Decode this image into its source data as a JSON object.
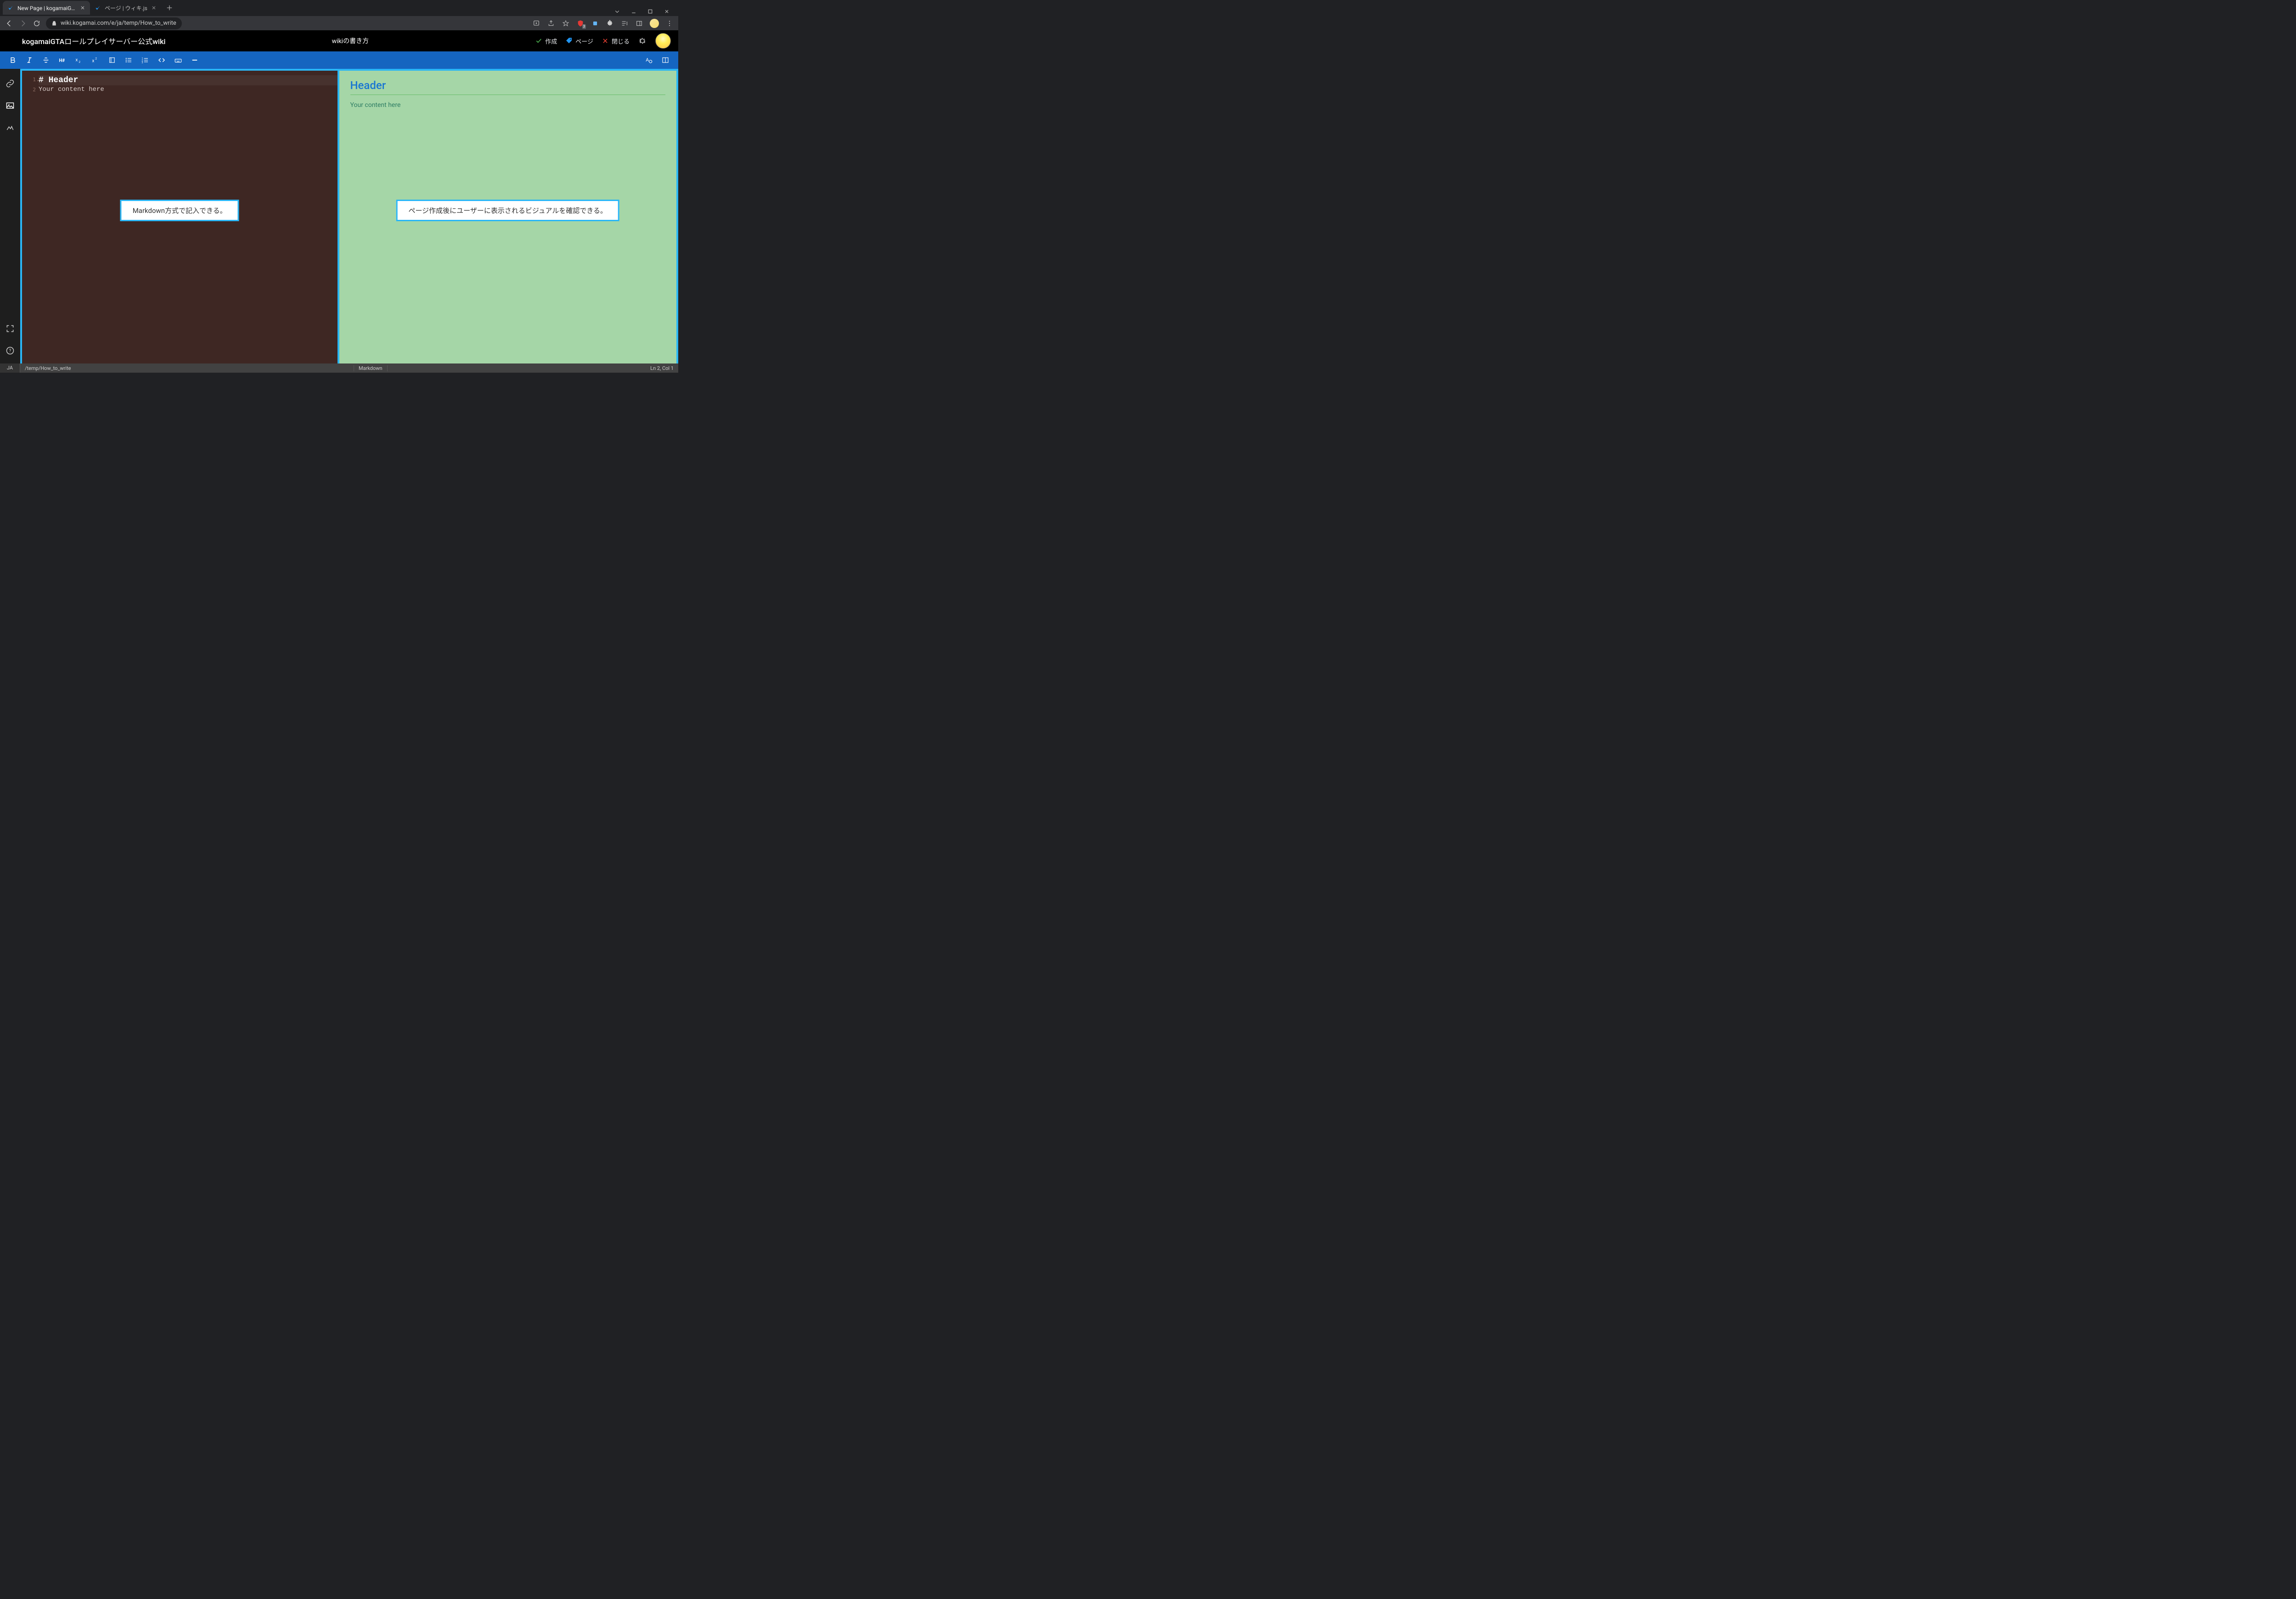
{
  "browser": {
    "tabs": [
      {
        "label": "New Page | kogamaiGTAロールプレ",
        "active": true
      },
      {
        "label": "ページ | ウィキ.js",
        "active": false
      }
    ],
    "url": "wiki.kogamai.com/e/ja/temp/How_to_write",
    "ext_badge": "3"
  },
  "app": {
    "title": "kogamaiGTAロールプレイサーバー公式wiki",
    "subtitle": "wikiの書き方",
    "actions": {
      "create": "作成",
      "page": "ページ",
      "close": "閉じる"
    }
  },
  "editor": {
    "lines": {
      "l1": "# Header",
      "l2": "Your content here",
      "n1": "1",
      "n2": "2"
    }
  },
  "preview": {
    "header": "Header",
    "body": "Your content here"
  },
  "callouts": {
    "left": "Markdown方式で記入できる。",
    "right": "ページ作成後にユーザーに表示されるビジュアルを確認できる。"
  },
  "status": {
    "lang": "JA",
    "path": "/temp/How_to_write",
    "mode": "Markdown",
    "pos": "Ln 2, Col 1"
  }
}
